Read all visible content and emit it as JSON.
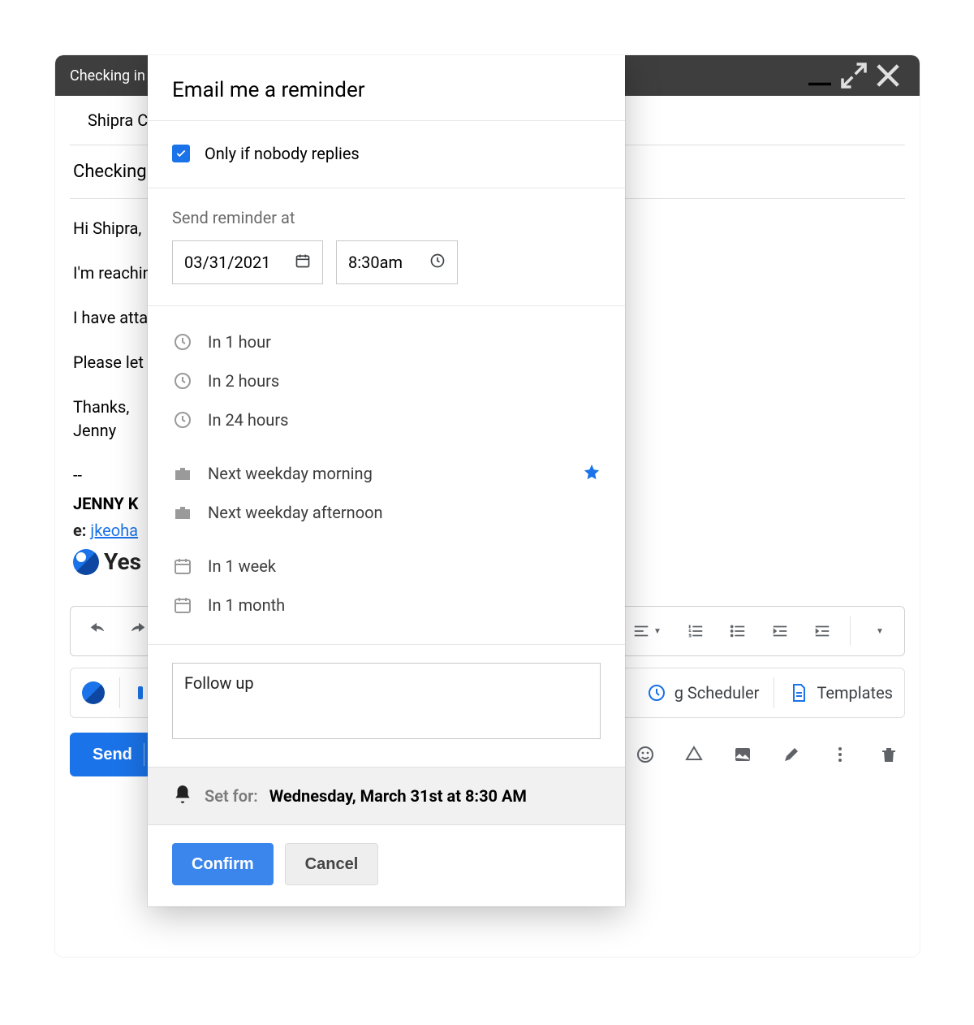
{
  "titlebar": {
    "title": "Checking in"
  },
  "recipient": "Shipra C",
  "subject": "Checking in",
  "body": {
    "greeting": "Hi Shipra,",
    "line1": "I'm reaching out because",
    "line2": "I have attached",
    "line3": "Please let me know",
    "closing1": "Thanks,",
    "closing2": "Jenny",
    "sigdash": "--",
    "signame": "JENNY K",
    "sigemail_label": "e:",
    "sigemail": "jkeoha",
    "siglogo": "Yes"
  },
  "extbar": {
    "scheduler": "g Scheduler",
    "templates": "Templates"
  },
  "send_label": "Send",
  "popup": {
    "title": "Email me a reminder",
    "only_if": "Only if nobody replies",
    "send_at_label": "Send reminder at",
    "date": "03/31/2021",
    "time": "8:30am",
    "opts": {
      "h1": "In 1 hour",
      "h2": "In 2 hours",
      "h24": "In 24 hours",
      "nwm": "Next weekday morning",
      "nwa": "Next weekday afternoon",
      "w1": "In 1 week",
      "m1": "In 1 month"
    },
    "note": "Follow up",
    "setfor_label": "Set for:",
    "setfor_value": "Wednesday, March 31st at 8:30 AM",
    "confirm": "Confirm",
    "cancel": "Cancel"
  }
}
